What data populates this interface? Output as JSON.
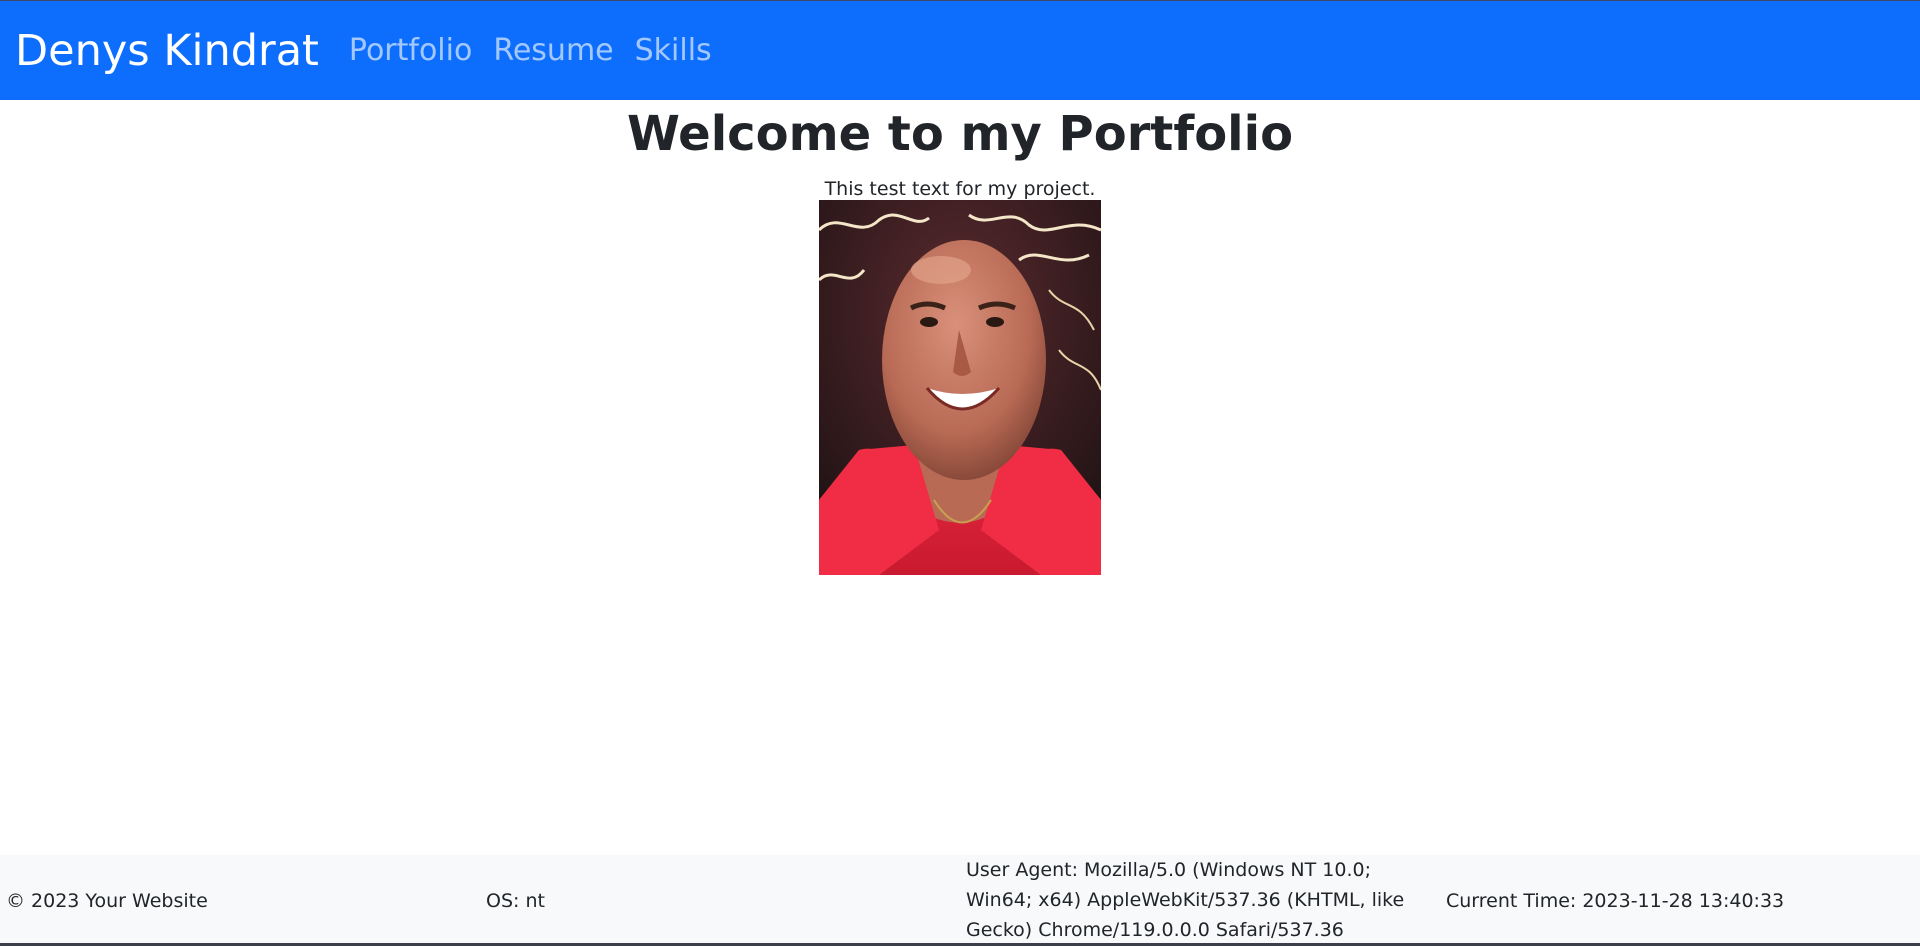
{
  "navbar": {
    "brand": "Denys Kindrat",
    "links": [
      "Portfolio",
      "Resume",
      "Skills"
    ]
  },
  "main": {
    "title": "Welcome to my Portfolio",
    "subtitle": "This test text for my project.",
    "image_description": "portrait photo of a bald smiling man in a red shirt"
  },
  "footer": {
    "copyright": "© 2023 Your Website",
    "os": "OS: nt",
    "user_agent": "User Agent: Mozilla/5.0 (Windows NT 10.0; Win64; x64) AppleWebKit/537.36 (KHTML, like Gecko) Chrome/119.0.0.0 Safari/537.36",
    "time": "Current Time: 2023-11-28 13:40:33"
  },
  "colors": {
    "navbar": "#0d6efd",
    "footer": "#f8f9fa",
    "text": "#212529"
  }
}
